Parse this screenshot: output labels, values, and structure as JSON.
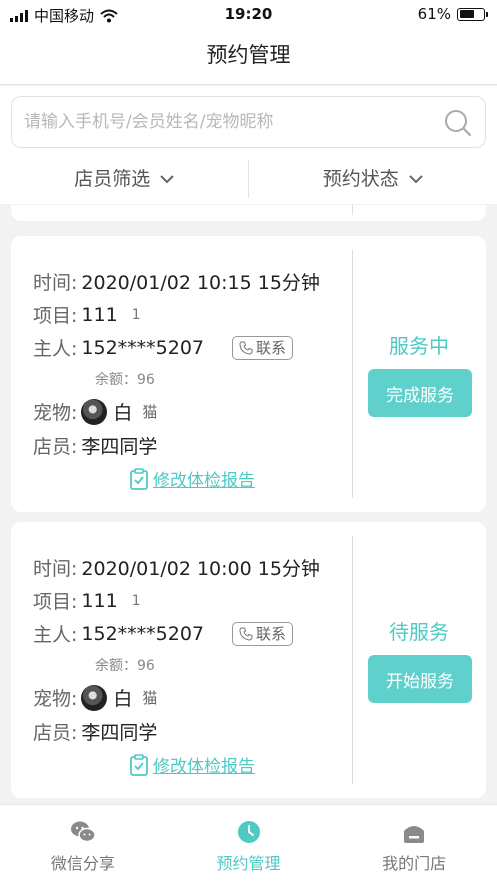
{
  "status_bar": {
    "carrier": "中国移动",
    "time": "19:20",
    "battery": "61%",
    "battery_level": 0.61
  },
  "nav": {
    "title": "预约管理"
  },
  "search": {
    "placeholder": "请输入手机号/会员姓名/宠物昵称"
  },
  "filters": {
    "staff": "店员筛选",
    "status": "预约状态"
  },
  "appointments": [
    {
      "time_label": "时间:",
      "time": "2020/01/02 10:15 15分钟",
      "item_label": "项目:",
      "item": "111",
      "item_count": "1",
      "owner_label": "主人:",
      "owner": "152****5207",
      "contact": "联系",
      "balance": "余额：96",
      "pet_label": "宠物:",
      "pet_name": "白",
      "pet_kind": "猫",
      "staff_label": "店员:",
      "staff": "李四同学",
      "report": "修改体检报告",
      "state": "服务中",
      "action": "完成服务"
    },
    {
      "time_label": "时间:",
      "time": "2020/01/02 10:00 15分钟",
      "item_label": "项目:",
      "item": "111",
      "item_count": "1",
      "owner_label": "主人:",
      "owner": "152****5207",
      "contact": "联系",
      "balance": "余额：96",
      "pet_label": "宠物:",
      "pet_name": "白",
      "pet_kind": "猫",
      "staff_label": "店员:",
      "staff": "李四同学",
      "report": "修改体检报告",
      "state": "待服务",
      "action": "开始服务"
    }
  ],
  "tabbar": {
    "tabs": [
      {
        "label": "微信分享",
        "icon": "wechat-icon"
      },
      {
        "label": "预约管理",
        "icon": "clock-icon"
      },
      {
        "label": "我的门店",
        "icon": "store-icon"
      }
    ]
  },
  "colors": {
    "accent": "#4ec9c4",
    "button": "#5fd0cb",
    "background": "#f2f2f2"
  }
}
